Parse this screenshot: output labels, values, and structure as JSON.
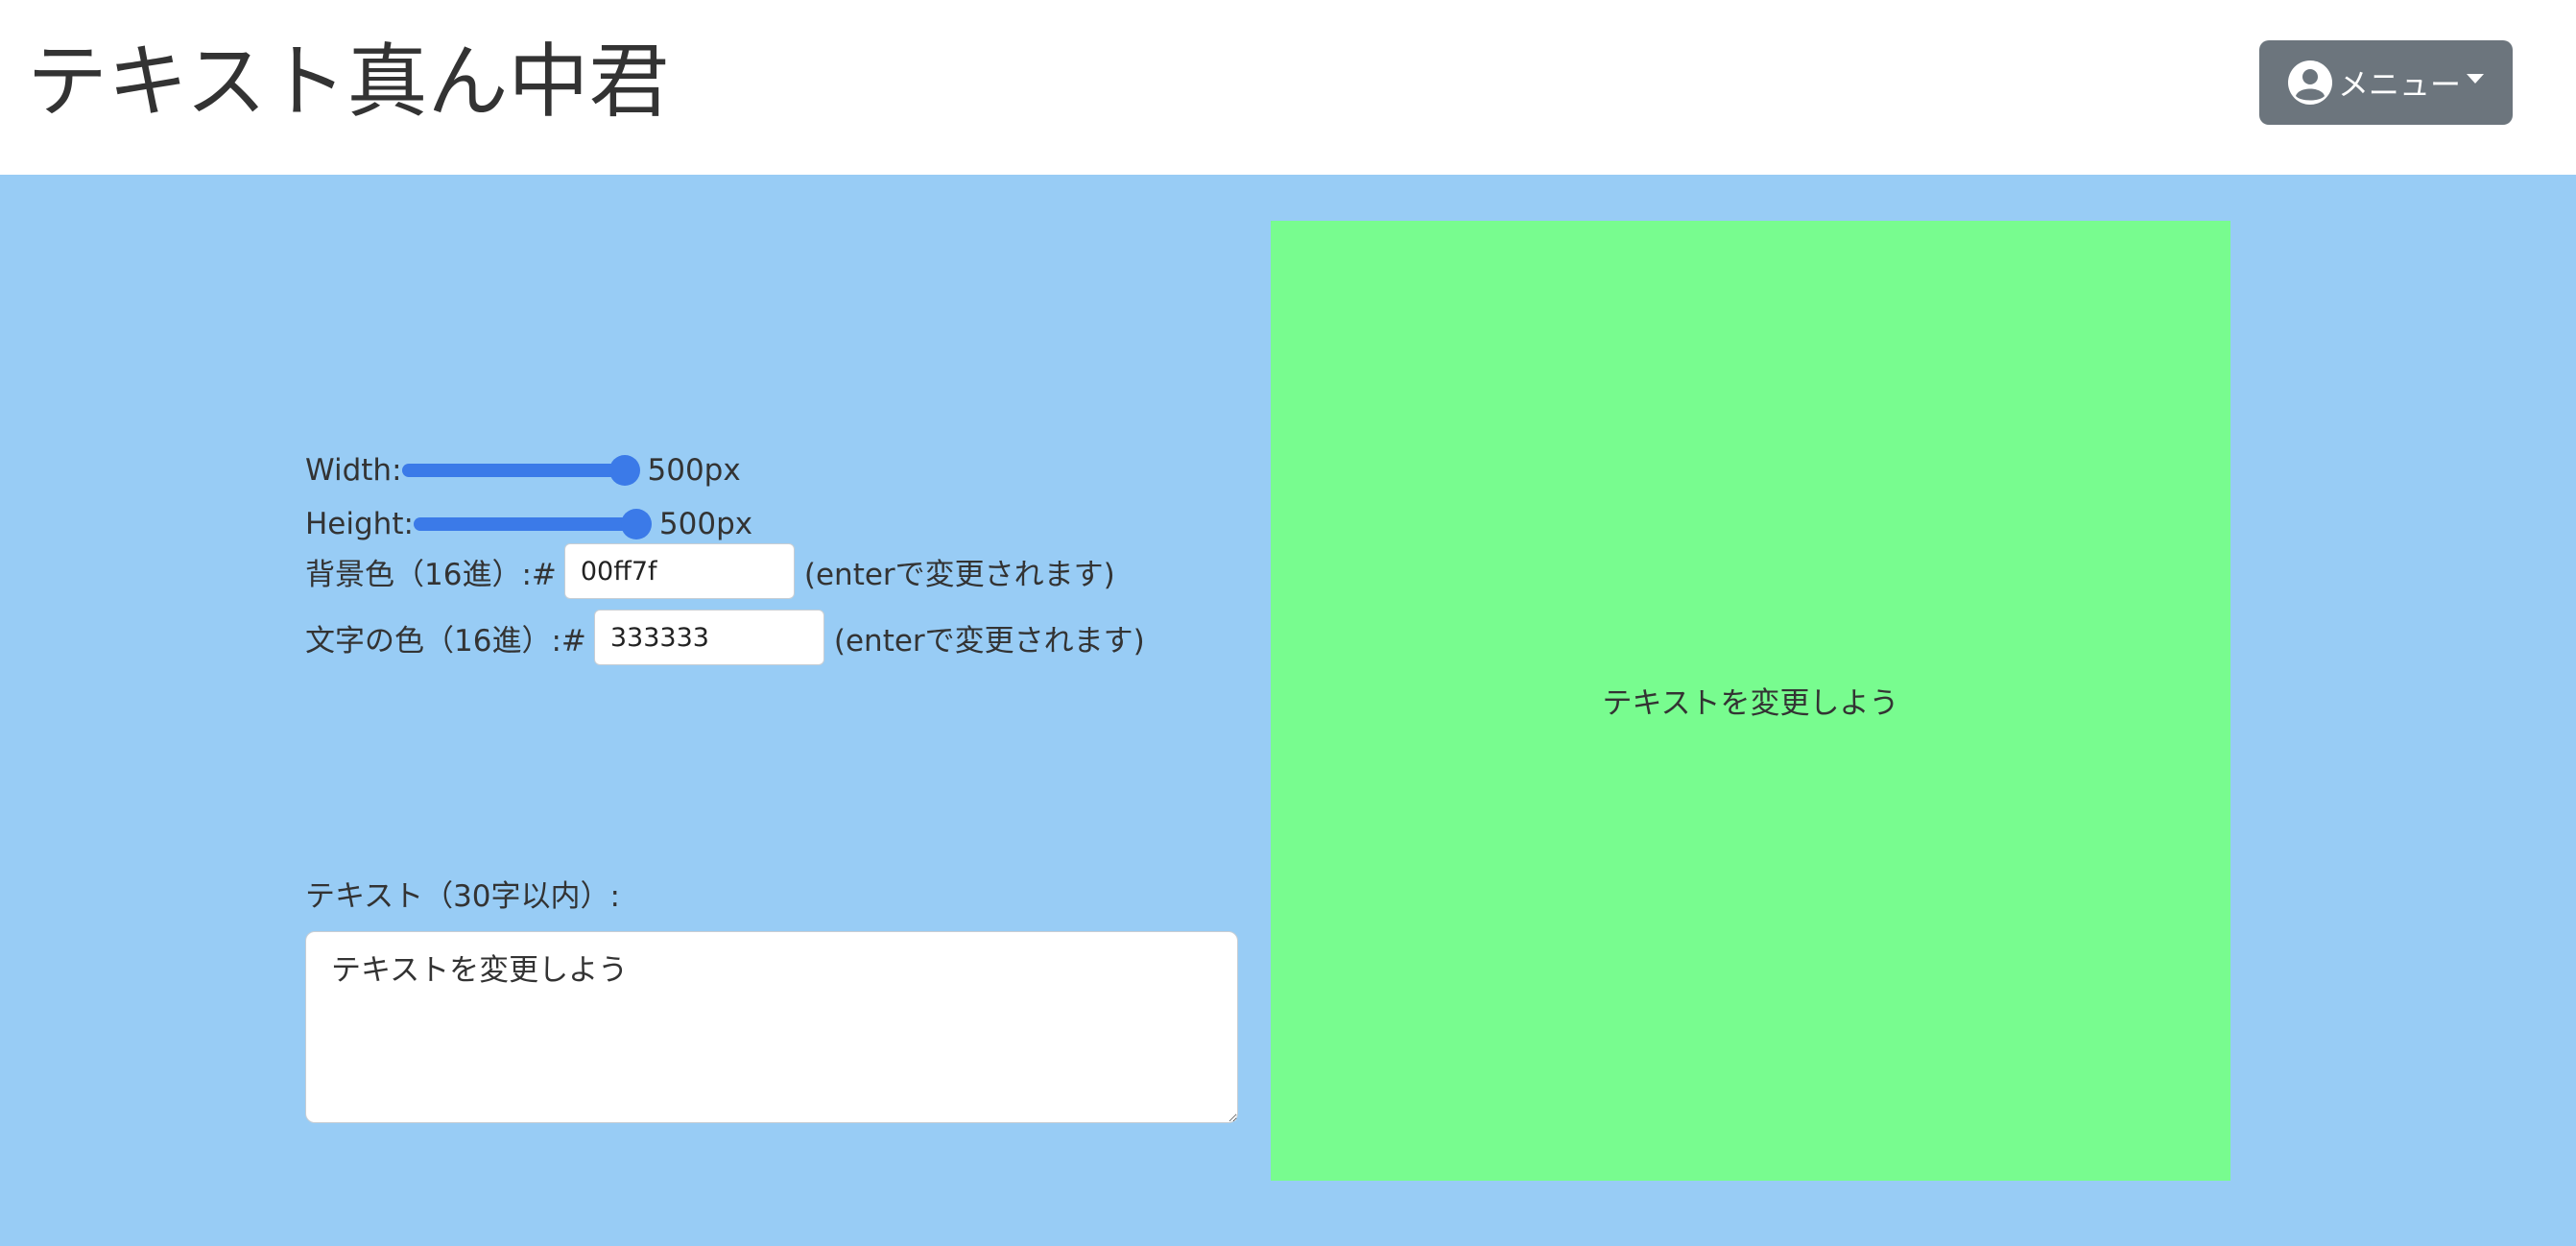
{
  "header": {
    "title": "テキスト真ん中君",
    "menu_label": "メニュー",
    "menu_icon": "user-circle-icon"
  },
  "controls": {
    "width_label": "Width:",
    "width_value": "500px",
    "width_slider_level": 1.0,
    "height_label": "Height:",
    "height_value": "500px",
    "height_slider_level": 1.0,
    "bg_color_label": "背景色（16進）:#",
    "bg_color_value": "00ff7f",
    "bg_color_hint": "(enterで変更されます)",
    "text_color_label": "文字の色（16進）:#",
    "text_color_value": "333333",
    "text_color_hint": "(enterで変更されます)",
    "text_label": "テキスト（30字以内）:",
    "text_value": "テキストを変更しよう"
  },
  "preview": {
    "text": "テキストを変更しよう",
    "background_color": "#00ff7f",
    "text_color": "#333333"
  },
  "colors": {
    "page_background": "#98ccf5",
    "header_background": "#ffffff",
    "menu_button": "#6c757d",
    "slider_accent": "#3b7ae8"
  }
}
